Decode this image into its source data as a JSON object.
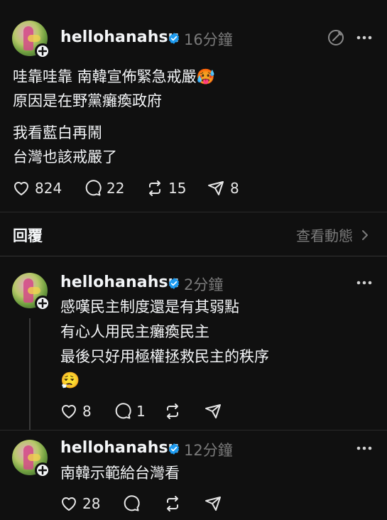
{
  "main_post": {
    "username": "hellohanahsu",
    "timestamp": "16分鐘",
    "lines": [
      "哇靠哇靠 南韓宣佈緊急戒嚴🥵",
      "原因是在野黨癱瘓政府",
      "我看藍白再鬧",
      "台灣也該戒嚴了"
    ],
    "likes": "824",
    "comments": "22",
    "reposts": "15",
    "shares": "8"
  },
  "replies_header": {
    "label": "回覆",
    "view_activity": "查看動態"
  },
  "reply1": {
    "username": "hellohanahsu",
    "timestamp": "2分鐘",
    "lines": [
      "感嘆民主制度還是有其弱點",
      "有心人用民主癱瘓民主",
      "最後只好用極權拯救民主的秩序",
      "😮‍💨"
    ],
    "likes": "8",
    "comments": "1"
  },
  "reply2": {
    "username": "hellohanahsu",
    "timestamp": "12分鐘",
    "lines": [
      "南韓示範給台灣看"
    ],
    "likes": "28"
  },
  "colors": {
    "background": "#101010",
    "verified": "#1d9bf0",
    "secondary_text": "#7a7a7a"
  },
  "icons": [
    "heart-icon",
    "comment-icon",
    "repost-icon",
    "share-icon",
    "more-icon",
    "edit-icon",
    "verified-icon",
    "plus-icon",
    "chevron-right-icon"
  ]
}
